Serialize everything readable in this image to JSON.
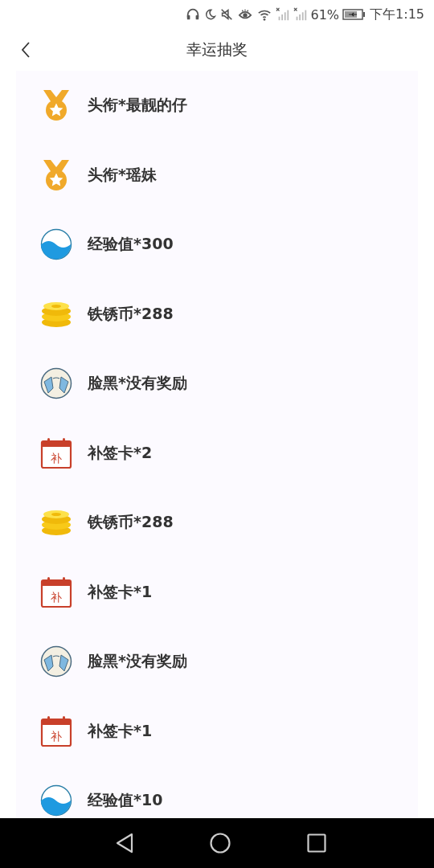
{
  "status_bar": {
    "battery": "61%",
    "time": "下午1:15"
  },
  "header": {
    "title": "幸运抽奖"
  },
  "prizes": [
    {
      "kind": "medal",
      "label": "头衔*最靓的仔"
    },
    {
      "kind": "medal",
      "label": "头衔*瑶妹"
    },
    {
      "kind": "exp",
      "label": "经验值*300"
    },
    {
      "kind": "coins",
      "label": "铁锈币*288"
    },
    {
      "kind": "none",
      "label": "脸黑*没有奖励"
    },
    {
      "kind": "card",
      "badge": "补",
      "label": "补签卡*2"
    },
    {
      "kind": "coins",
      "label": "铁锈币*288"
    },
    {
      "kind": "card",
      "badge": "补",
      "label": "补签卡*1"
    },
    {
      "kind": "none",
      "label": "脸黑*没有奖励"
    },
    {
      "kind": "card",
      "badge": "补",
      "label": "补签卡*1"
    },
    {
      "kind": "exp",
      "label": "经验值*10"
    }
  ]
}
